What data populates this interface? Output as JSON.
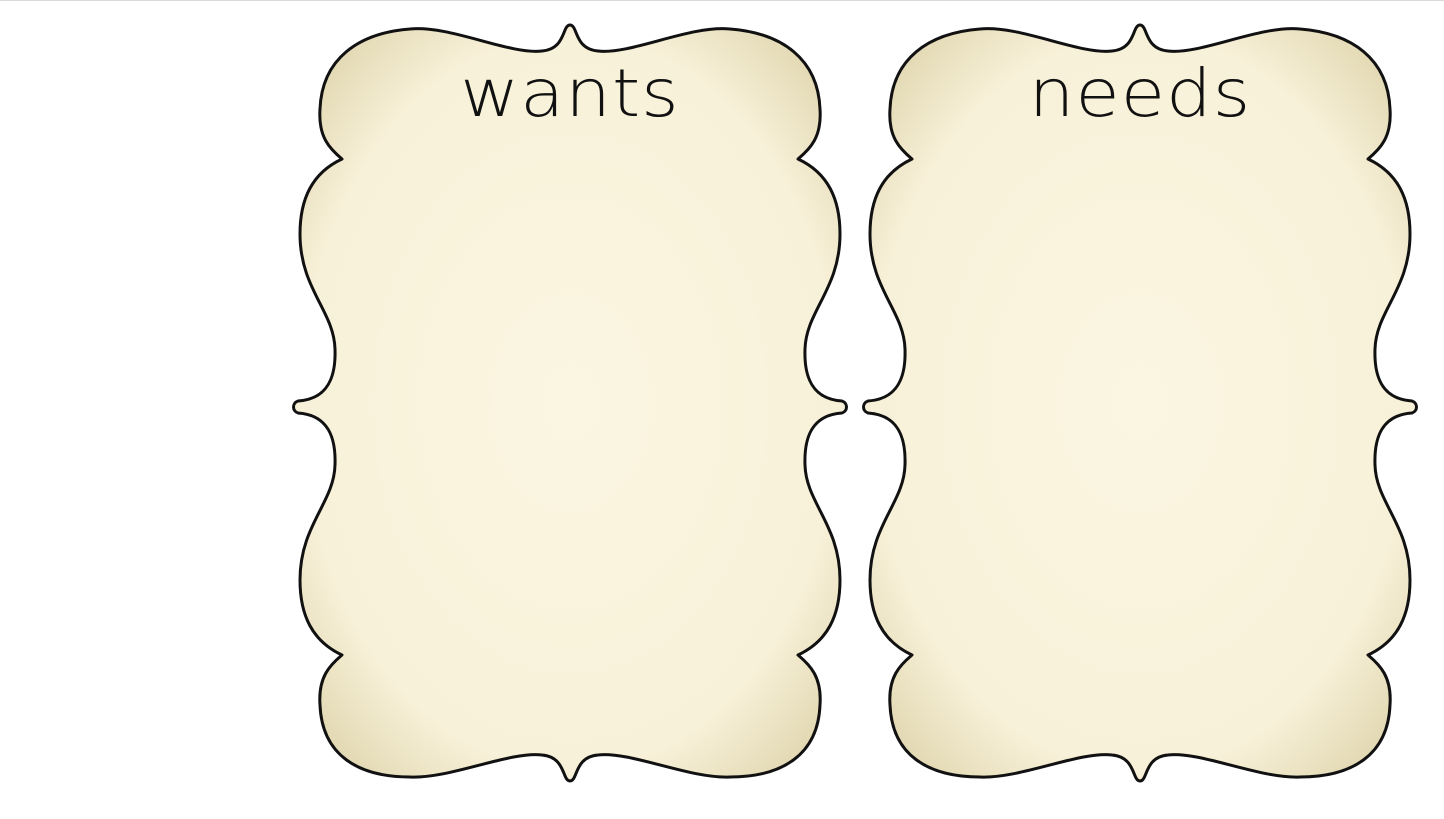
{
  "slide": {
    "background_color": "#ffffff",
    "frames": [
      {
        "title": "wants",
        "fill_color": "#f9f3dd",
        "edge_color": "#e6dcb8",
        "outline_color": "#111111"
      },
      {
        "title": "needs",
        "fill_color": "#f9f3dd",
        "edge_color": "#e6dcb8",
        "outline_color": "#111111"
      }
    ]
  }
}
